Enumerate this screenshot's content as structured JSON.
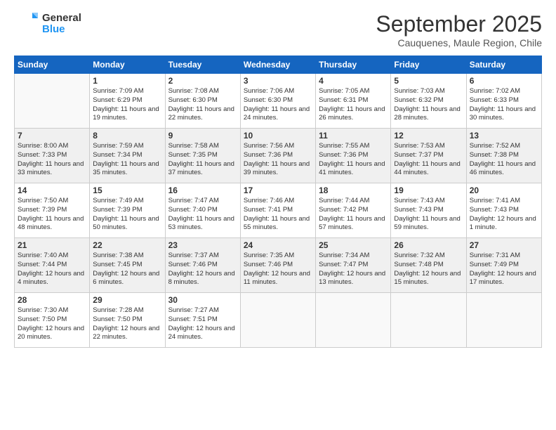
{
  "logo": {
    "general": "General",
    "blue": "Blue"
  },
  "title": "September 2025",
  "subtitle": "Cauquenes, Maule Region, Chile",
  "days": [
    "Sunday",
    "Monday",
    "Tuesday",
    "Wednesday",
    "Thursday",
    "Friday",
    "Saturday"
  ],
  "weeks": [
    [
      {
        "day": "",
        "sunrise": "",
        "sunset": "",
        "daylight": ""
      },
      {
        "day": "1",
        "sunrise": "Sunrise: 7:09 AM",
        "sunset": "Sunset: 6:29 PM",
        "daylight": "Daylight: 11 hours and 19 minutes."
      },
      {
        "day": "2",
        "sunrise": "Sunrise: 7:08 AM",
        "sunset": "Sunset: 6:30 PM",
        "daylight": "Daylight: 11 hours and 22 minutes."
      },
      {
        "day": "3",
        "sunrise": "Sunrise: 7:06 AM",
        "sunset": "Sunset: 6:30 PM",
        "daylight": "Daylight: 11 hours and 24 minutes."
      },
      {
        "day": "4",
        "sunrise": "Sunrise: 7:05 AM",
        "sunset": "Sunset: 6:31 PM",
        "daylight": "Daylight: 11 hours and 26 minutes."
      },
      {
        "day": "5",
        "sunrise": "Sunrise: 7:03 AM",
        "sunset": "Sunset: 6:32 PM",
        "daylight": "Daylight: 11 hours and 28 minutes."
      },
      {
        "day": "6",
        "sunrise": "Sunrise: 7:02 AM",
        "sunset": "Sunset: 6:33 PM",
        "daylight": "Daylight: 11 hours and 30 minutes."
      }
    ],
    [
      {
        "day": "7",
        "sunrise": "Sunrise: 8:00 AM",
        "sunset": "Sunset: 7:33 PM",
        "daylight": "Daylight: 11 hours and 33 minutes."
      },
      {
        "day": "8",
        "sunrise": "Sunrise: 7:59 AM",
        "sunset": "Sunset: 7:34 PM",
        "daylight": "Daylight: 11 hours and 35 minutes."
      },
      {
        "day": "9",
        "sunrise": "Sunrise: 7:58 AM",
        "sunset": "Sunset: 7:35 PM",
        "daylight": "Daylight: 11 hours and 37 minutes."
      },
      {
        "day": "10",
        "sunrise": "Sunrise: 7:56 AM",
        "sunset": "Sunset: 7:36 PM",
        "daylight": "Daylight: 11 hours and 39 minutes."
      },
      {
        "day": "11",
        "sunrise": "Sunrise: 7:55 AM",
        "sunset": "Sunset: 7:36 PM",
        "daylight": "Daylight: 11 hours and 41 minutes."
      },
      {
        "day": "12",
        "sunrise": "Sunrise: 7:53 AM",
        "sunset": "Sunset: 7:37 PM",
        "daylight": "Daylight: 11 hours and 44 minutes."
      },
      {
        "day": "13",
        "sunrise": "Sunrise: 7:52 AM",
        "sunset": "Sunset: 7:38 PM",
        "daylight": "Daylight: 11 hours and 46 minutes."
      }
    ],
    [
      {
        "day": "14",
        "sunrise": "Sunrise: 7:50 AM",
        "sunset": "Sunset: 7:39 PM",
        "daylight": "Daylight: 11 hours and 48 minutes."
      },
      {
        "day": "15",
        "sunrise": "Sunrise: 7:49 AM",
        "sunset": "Sunset: 7:39 PM",
        "daylight": "Daylight: 11 hours and 50 minutes."
      },
      {
        "day": "16",
        "sunrise": "Sunrise: 7:47 AM",
        "sunset": "Sunset: 7:40 PM",
        "daylight": "Daylight: 11 hours and 53 minutes."
      },
      {
        "day": "17",
        "sunrise": "Sunrise: 7:46 AM",
        "sunset": "Sunset: 7:41 PM",
        "daylight": "Daylight: 11 hours and 55 minutes."
      },
      {
        "day": "18",
        "sunrise": "Sunrise: 7:44 AM",
        "sunset": "Sunset: 7:42 PM",
        "daylight": "Daylight: 11 hours and 57 minutes."
      },
      {
        "day": "19",
        "sunrise": "Sunrise: 7:43 AM",
        "sunset": "Sunset: 7:43 PM",
        "daylight": "Daylight: 11 hours and 59 minutes."
      },
      {
        "day": "20",
        "sunrise": "Sunrise: 7:41 AM",
        "sunset": "Sunset: 7:43 PM",
        "daylight": "Daylight: 12 hours and 1 minute."
      }
    ],
    [
      {
        "day": "21",
        "sunrise": "Sunrise: 7:40 AM",
        "sunset": "Sunset: 7:44 PM",
        "daylight": "Daylight: 12 hours and 4 minutes."
      },
      {
        "day": "22",
        "sunrise": "Sunrise: 7:38 AM",
        "sunset": "Sunset: 7:45 PM",
        "daylight": "Daylight: 12 hours and 6 minutes."
      },
      {
        "day": "23",
        "sunrise": "Sunrise: 7:37 AM",
        "sunset": "Sunset: 7:46 PM",
        "daylight": "Daylight: 12 hours and 8 minutes."
      },
      {
        "day": "24",
        "sunrise": "Sunrise: 7:35 AM",
        "sunset": "Sunset: 7:46 PM",
        "daylight": "Daylight: 12 hours and 11 minutes."
      },
      {
        "day": "25",
        "sunrise": "Sunrise: 7:34 AM",
        "sunset": "Sunset: 7:47 PM",
        "daylight": "Daylight: 12 hours and 13 minutes."
      },
      {
        "day": "26",
        "sunrise": "Sunrise: 7:32 AM",
        "sunset": "Sunset: 7:48 PM",
        "daylight": "Daylight: 12 hours and 15 minutes."
      },
      {
        "day": "27",
        "sunrise": "Sunrise: 7:31 AM",
        "sunset": "Sunset: 7:49 PM",
        "daylight": "Daylight: 12 hours and 17 minutes."
      }
    ],
    [
      {
        "day": "28",
        "sunrise": "Sunrise: 7:30 AM",
        "sunset": "Sunset: 7:50 PM",
        "daylight": "Daylight: 12 hours and 20 minutes."
      },
      {
        "day": "29",
        "sunrise": "Sunrise: 7:28 AM",
        "sunset": "Sunset: 7:50 PM",
        "daylight": "Daylight: 12 hours and 22 minutes."
      },
      {
        "day": "30",
        "sunrise": "Sunrise: 7:27 AM",
        "sunset": "Sunset: 7:51 PM",
        "daylight": "Daylight: 12 hours and 24 minutes."
      },
      {
        "day": "",
        "sunrise": "",
        "sunset": "",
        "daylight": ""
      },
      {
        "day": "",
        "sunrise": "",
        "sunset": "",
        "daylight": ""
      },
      {
        "day": "",
        "sunrise": "",
        "sunset": "",
        "daylight": ""
      },
      {
        "day": "",
        "sunrise": "",
        "sunset": "",
        "daylight": ""
      }
    ]
  ]
}
